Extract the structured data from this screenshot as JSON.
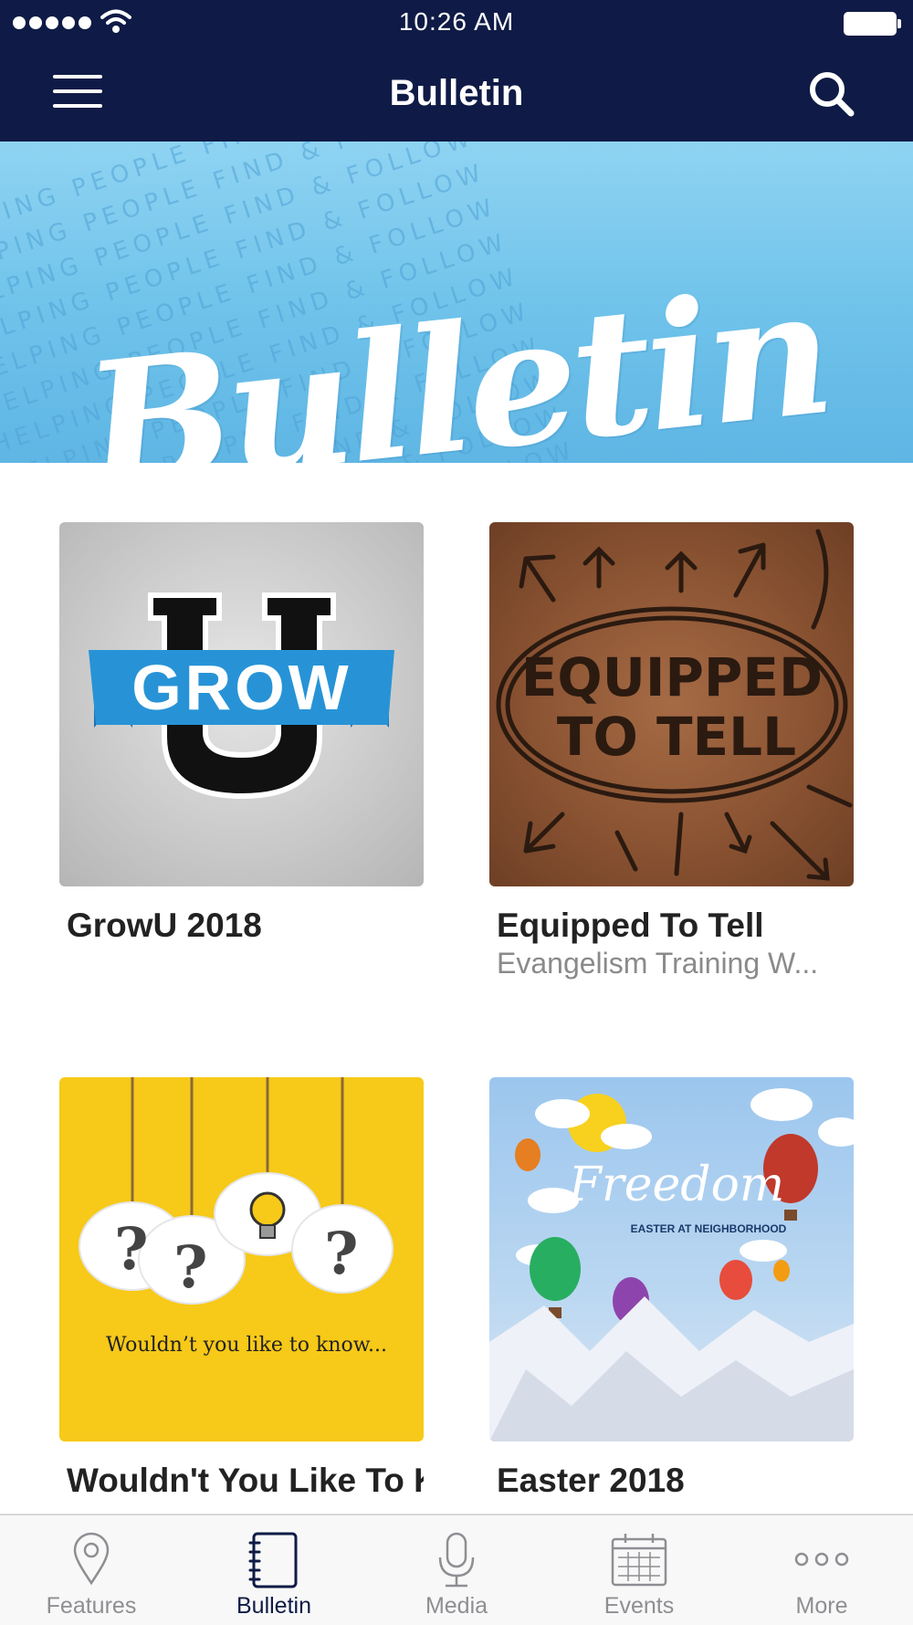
{
  "status_bar": {
    "time": "10:26 AM"
  },
  "header": {
    "title": "Bulletin"
  },
  "banner": {
    "title": "Bulletin",
    "pattern_text": "GOD HELPING PEOPLE FIND & FOLLOW"
  },
  "cards": [
    {
      "title": "GrowU 2018",
      "subtitle": "",
      "image_text": "GROW"
    },
    {
      "title": "Equipped To Tell",
      "subtitle": "Evangelism Training W...",
      "image_text_line1": "EQUIPPED",
      "image_text_line2": "TO TELL"
    },
    {
      "title": "Wouldn't You Like To K...",
      "subtitle": "",
      "image_text": "Wouldn’t you like to know..."
    },
    {
      "title": "Easter 2018",
      "subtitle": "",
      "image_title": "Freedom",
      "image_subtitle": "EASTER AT NEIGHBORHOOD"
    }
  ],
  "tabs": [
    {
      "label": "Features",
      "icon": "map-pin-icon"
    },
    {
      "label": "Bulletin",
      "icon": "notebook-icon"
    },
    {
      "label": "Media",
      "icon": "microphone-icon"
    },
    {
      "label": "Events",
      "icon": "calendar-icon"
    },
    {
      "label": "More",
      "icon": "more-dots-icon"
    }
  ],
  "colors": {
    "navy": "#0f1b46",
    "banner_blue": "#6ec2ea",
    "inactive_tab": "#8e8e93"
  }
}
